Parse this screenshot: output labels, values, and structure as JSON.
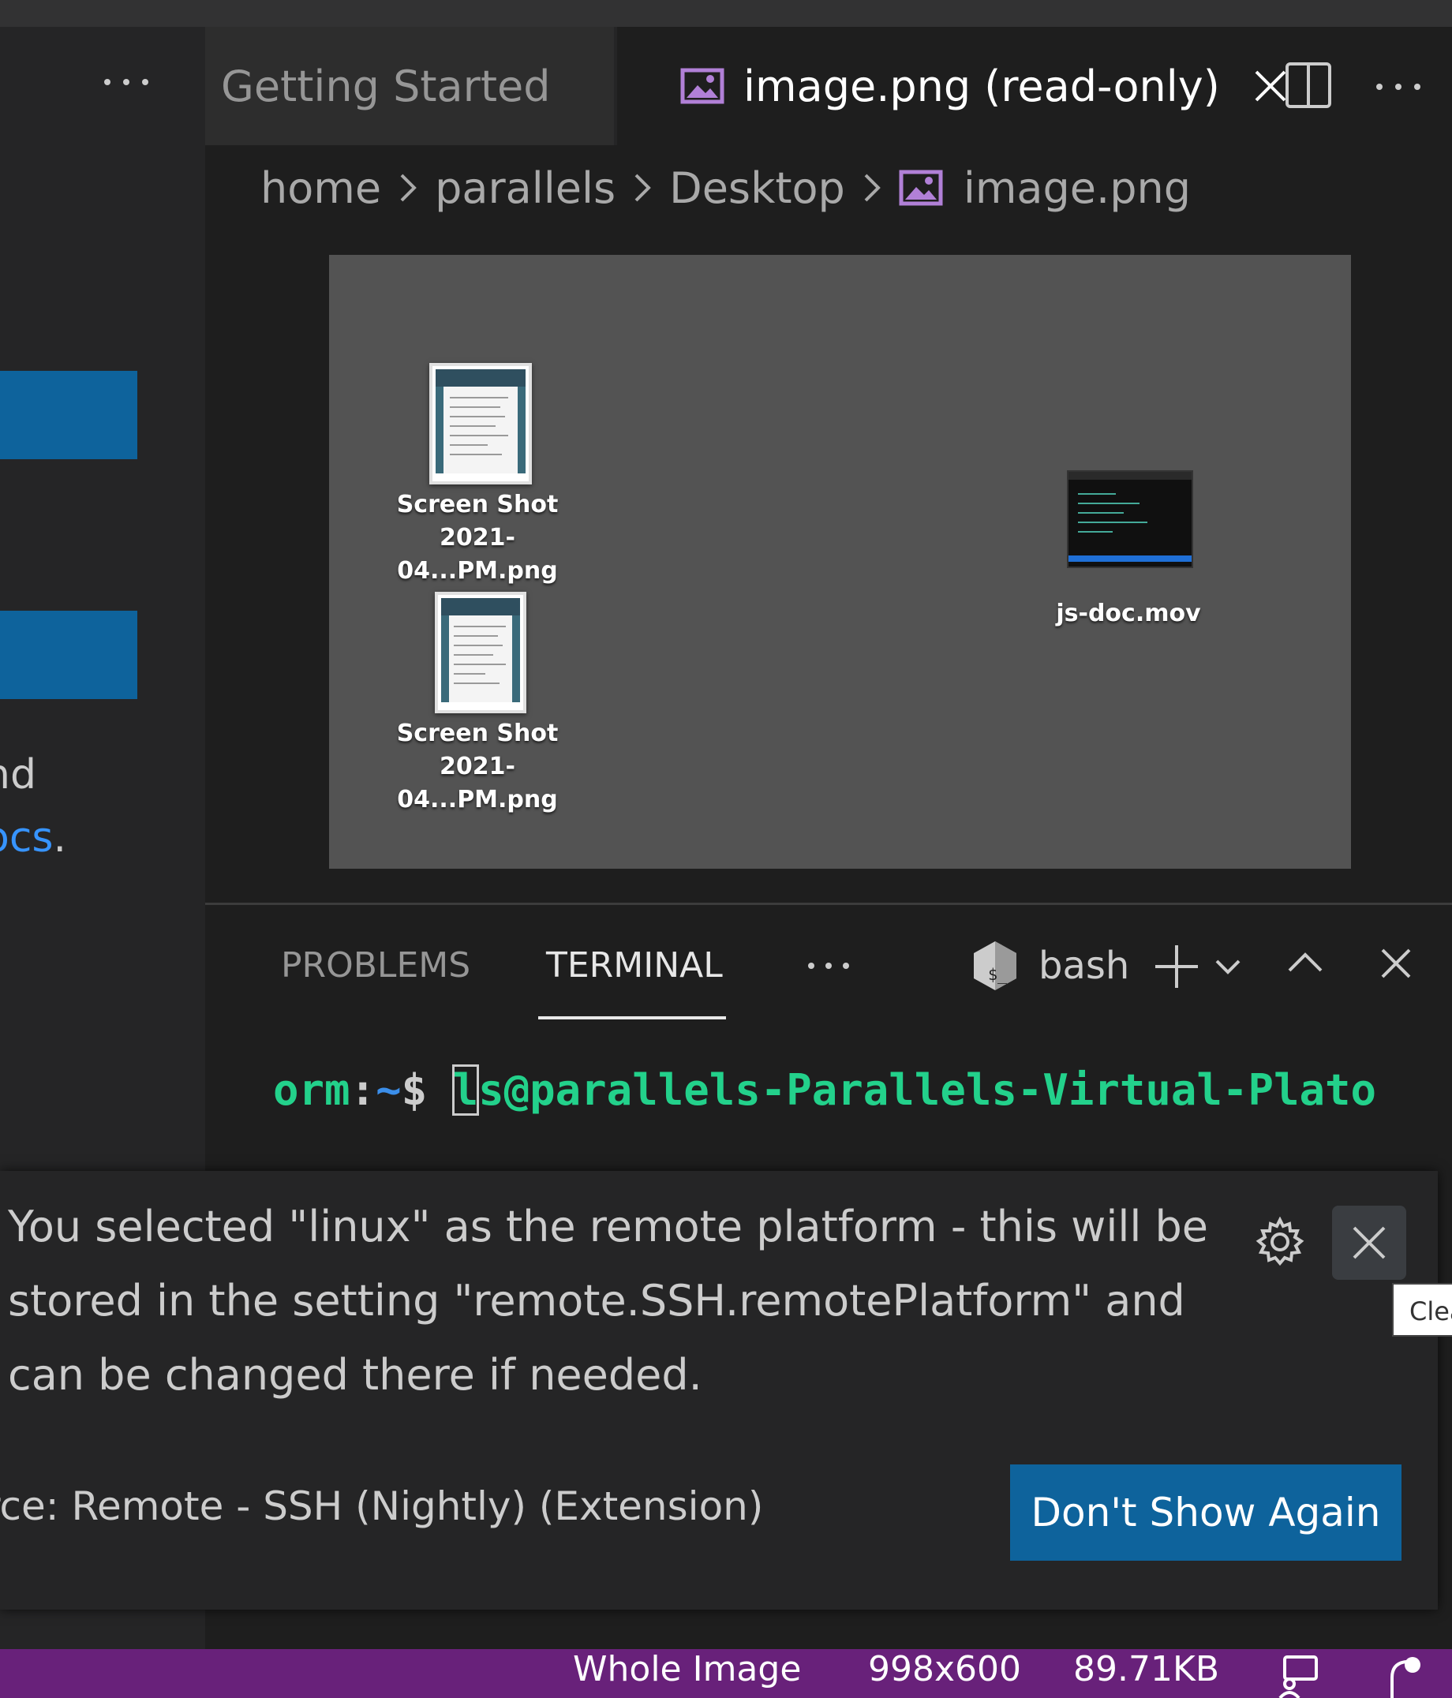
{
  "sidebar": {
    "text_line1": "nd",
    "text_line2_link": "ocs",
    "text_line2_suffix": "."
  },
  "tabs": [
    {
      "label": "Getting Started"
    },
    {
      "label": "image.png (read-only)"
    }
  ],
  "breadcrumb": [
    "home",
    "parallels",
    "Desktop",
    "image.png"
  ],
  "desktop_files": [
    {
      "line1": "Screen Shot",
      "line2": "2021-04...PM.png"
    },
    {
      "line1": "Screen Shot",
      "line2": "2021-04...PM.png"
    },
    {
      "line1": "js-doc.mov"
    }
  ],
  "panel": {
    "tabs": [
      "PROBLEMS",
      "TERMINAL"
    ],
    "active_tab": "TERMINAL",
    "shell": "bash"
  },
  "terminal": {
    "prompt_host": "orm",
    "prompt_path": "~",
    "prompt_symbol": "$ ",
    "cursor_char": "l",
    "rest": "s@parallels-Parallels-Virtual-Plato"
  },
  "notification": {
    "message": "You selected \"linux\" as the remote platform - this will be stored in the setting \"remote.SSH.remotePlatform\" and can be changed there if needed.",
    "source": "rce: Remote - SSH (Nightly) (Extension)",
    "button": "Don't Show Again",
    "tooltip": "Clea"
  },
  "statusbar": {
    "selection": "Whole Image",
    "dimensions": "998x600",
    "size": "89.71KB"
  },
  "colors": {
    "accent": "#0e639c",
    "statusbar": "#68217a",
    "terminal_green": "#23d18b",
    "terminal_blue": "#3b8eea",
    "image_icon": "#b180d7"
  }
}
